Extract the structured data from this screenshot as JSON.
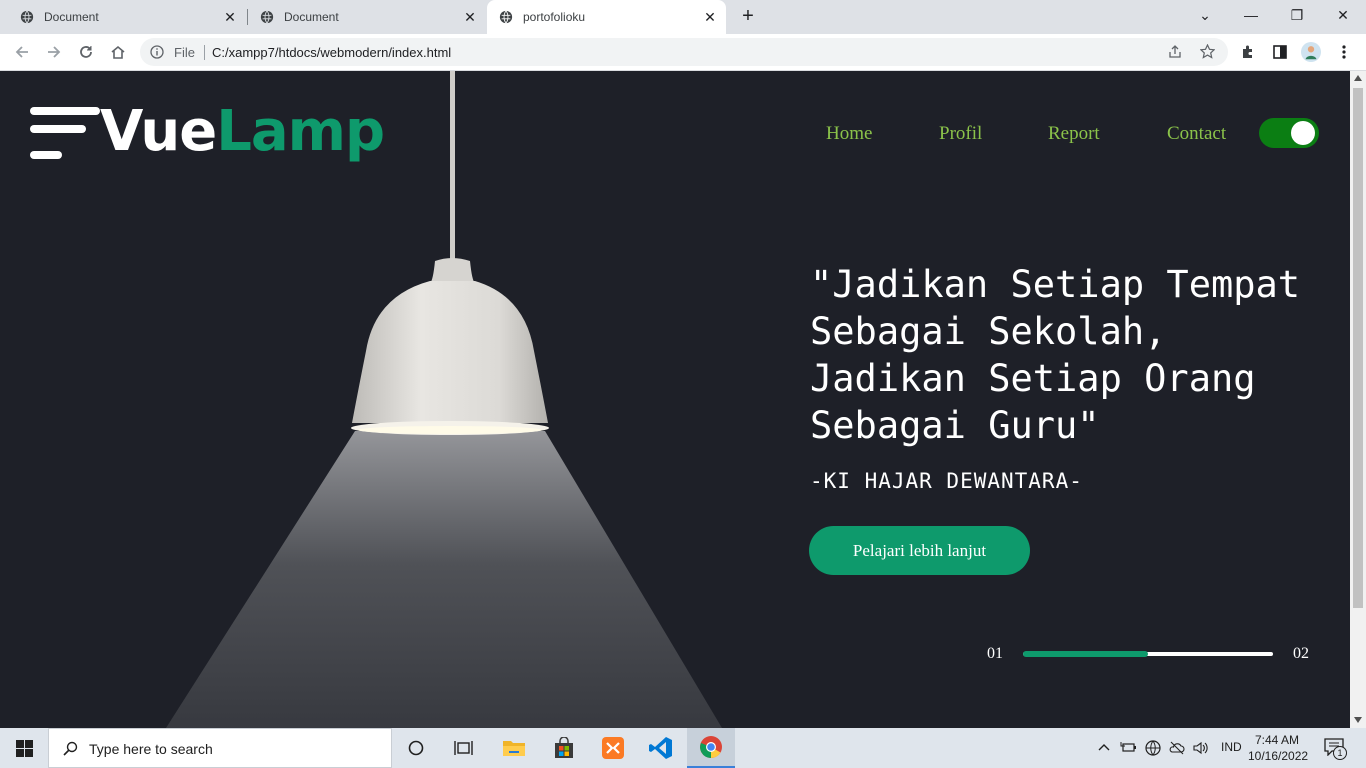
{
  "browser": {
    "tabs": [
      {
        "title": "Document",
        "active": false
      },
      {
        "title": "Document",
        "active": false
      },
      {
        "title": "portofolioku",
        "active": true
      }
    ],
    "new_tab_label": "+",
    "file_label": "File",
    "url": "C:/xampp7/htdocs/webmodern/index.html"
  },
  "site": {
    "logo": {
      "part1": "Vue",
      "part2": "Lamp"
    },
    "nav": [
      "Home",
      "Profil",
      "Report",
      "Contact"
    ],
    "toggle_on": true,
    "quote": "\"Jadikan Setiap Tempat\nSebagai Sekolah,\nJadikan Setiap Orang\nSebagai Guru\"",
    "author": "-KI HAJAR DEWANTARA-",
    "cta_label": "Pelajari lebih lanjut",
    "slider": {
      "current": "01",
      "total": "02",
      "progress": 0.5
    },
    "colors": {
      "accent": "#0e9a6c",
      "nav": "#8bc34a",
      "background": "#1e2028",
      "toggle": "#0b7e13"
    }
  },
  "taskbar": {
    "search_placeholder": "Type here to search",
    "language": "IND",
    "time": "7:44 AM",
    "date": "10/16/2022",
    "notification_count": "1"
  }
}
